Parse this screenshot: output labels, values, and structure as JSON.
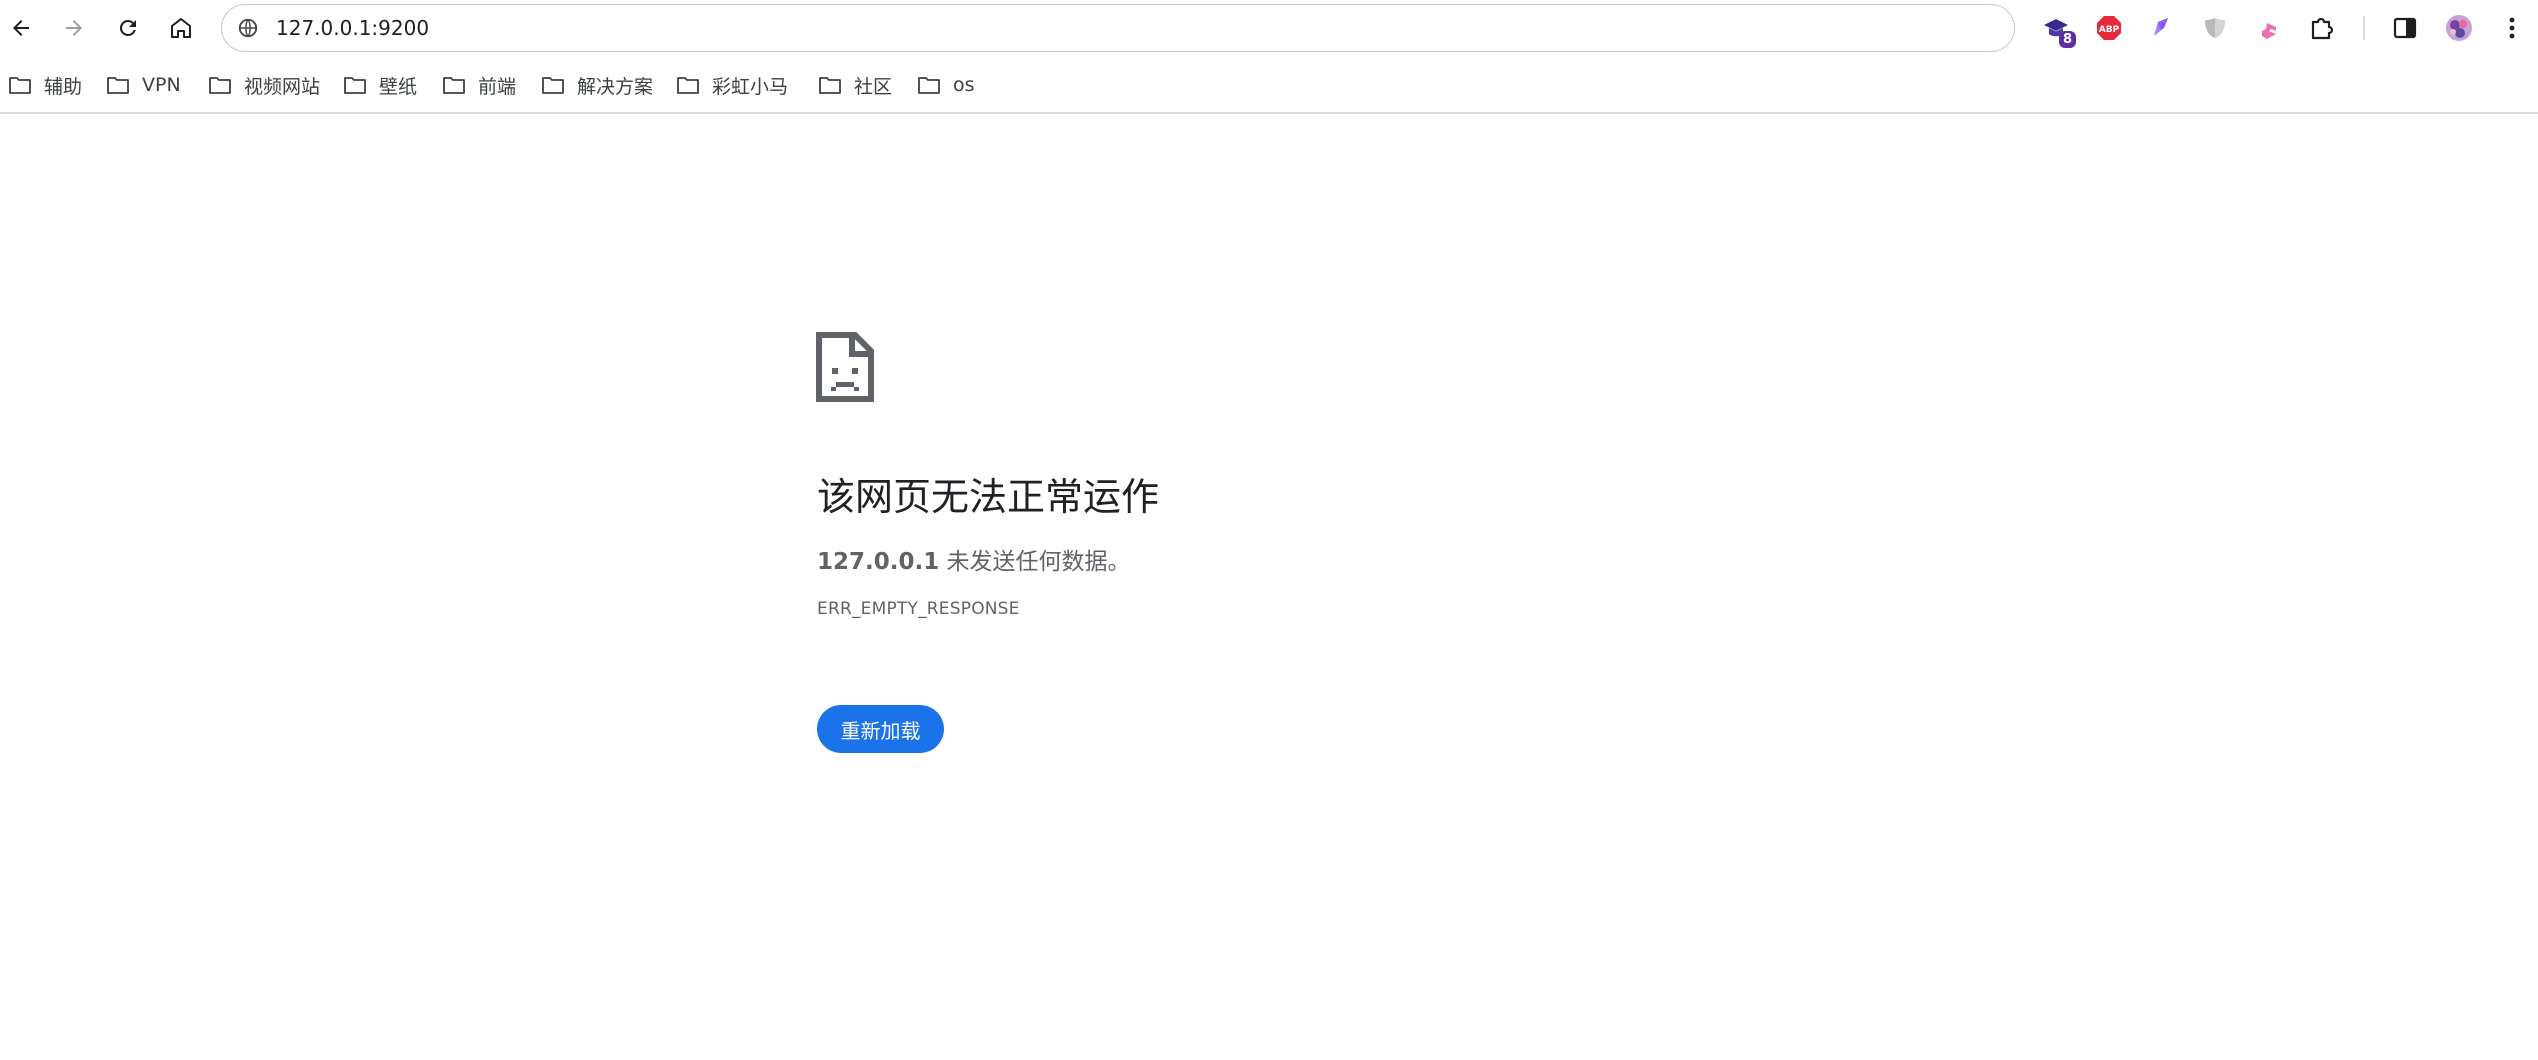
{
  "toolbar": {
    "back": "back-arrow",
    "forward": "forward-arrow",
    "reload": "reload",
    "home": "home",
    "url": "127.0.0.1:9200",
    "extensions": [
      {
        "name": "mortarboard-extension",
        "badge": "8"
      },
      {
        "name": "adblock-plus",
        "label": "ABP"
      },
      {
        "name": "pen-extension"
      },
      {
        "name": "shield-extension"
      },
      {
        "name": "bing"
      },
      {
        "name": "extensions-puzzle"
      }
    ]
  },
  "bookmarks": [
    {
      "label": "辅助"
    },
    {
      "label": "VPN"
    },
    {
      "label": "视频网站"
    },
    {
      "label": "壁纸"
    },
    {
      "label": "前端"
    },
    {
      "label": "解决方案"
    },
    {
      "label": "彩虹小马"
    },
    {
      "label": "社区"
    },
    {
      "label": "os"
    }
  ],
  "error": {
    "title": "该网页无法正常运作",
    "host": "127.0.0.1",
    "message": " 未发送任何数据。",
    "code": "ERR_EMPTY_RESPONSE",
    "reload_label": "重新加载"
  },
  "colors": {
    "accent": "#1a73e8",
    "text": "#202124",
    "muted": "#5f6368"
  }
}
